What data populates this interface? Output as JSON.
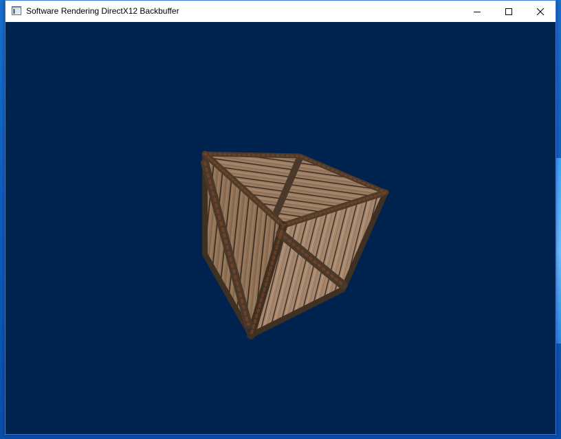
{
  "window": {
    "title": "Software Rendering DirectX12 Backbuffer",
    "controls": {
      "minimize": "minimize-icon",
      "maximize": "maximize-icon",
      "close": "close-icon"
    }
  },
  "viewport": {
    "clear_color": "#00224e",
    "object": "wooden-crate"
  },
  "colors": {
    "desktop": "#0e5fc2",
    "wood_light": "#a8876a",
    "wood_dark": "#5e4330",
    "iron_band": "#4a3a2c",
    "rust": "#8a4a22"
  }
}
